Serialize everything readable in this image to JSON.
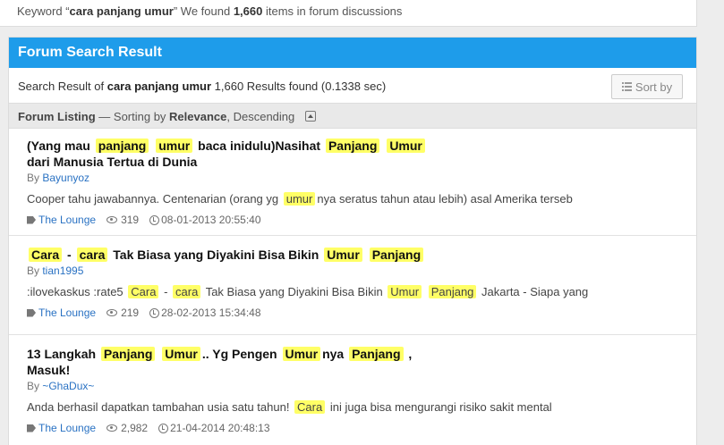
{
  "top": {
    "keyword_prefix": "Keyword “",
    "keyword": "cara panjang umur",
    "keyword_mid": "” We found ",
    "count": "1,660",
    "keyword_suffix": " items in forum discussions"
  },
  "panel": {
    "title": "Forum Search Result",
    "result_prefix": "Search Result of ",
    "result_keyword": "cara panjang umur",
    "result_suffix": " 1,660 Results found (0.1338 sec)",
    "sort_label": "Sort by",
    "listing_label": "Forum Listing",
    "listing_mid": " — Sorting by ",
    "listing_sort": "Relevance",
    "listing_order": ", Descending"
  },
  "results": [
    {
      "title_parts": [
        "(Yang mau ",
        "panjang",
        " ",
        "umur",
        " baca inidulu)Nasihat ",
        "Panjang",
        " ",
        "Umur"
      ],
      "title_line2": "dari Manusia Tertua di Dunia",
      "by_label": "By ",
      "author": "Bayunyoz",
      "snippet_parts": [
        "Cooper tahu jawabannya. Centenarian (orang yg ",
        "umur",
        "nya seratus tahun atau lebih) asal Amerika terseb"
      ],
      "forum": "The Lounge",
      "views": "319",
      "date": "08-01-2013 20:55:40"
    },
    {
      "title_parts": [
        "Cara",
        " - ",
        "cara",
        " Tak Biasa yang Diyakini Bisa Bikin ",
        "Umur",
        " ",
        "Panjang"
      ],
      "by_label": "By ",
      "author": "tian1995",
      "snippet_parts": [
        ":ilovekaskus :rate5 ",
        "Cara",
        " - ",
        "cara",
        " Tak Biasa yang Diyakini Bisa Bikin ",
        "Umur",
        " ",
        "Panjang",
        " Jakarta - Siapa yang"
      ],
      "forum": "The Lounge",
      "views": "219",
      "date": "28-02-2013 15:34:48"
    },
    {
      "title_parts": [
        "13 Langkah ",
        "Panjang",
        " ",
        "Umur",
        ".. Yg Pengen ",
        "Umur",
        "nya ",
        "Panjang",
        " ,"
      ],
      "title_line2": "Masuk!",
      "by_label": "By ",
      "author": "~GhaDux~",
      "snippet_parts": [
        "Anda berhasil dapatkan tambahan usia satu tahun! ",
        "Cara",
        " ini juga bisa mengurangi risiko sakit mental"
      ],
      "forum": "The Lounge",
      "views": "2,982",
      "date": "21-04-2014 20:48:13"
    }
  ]
}
